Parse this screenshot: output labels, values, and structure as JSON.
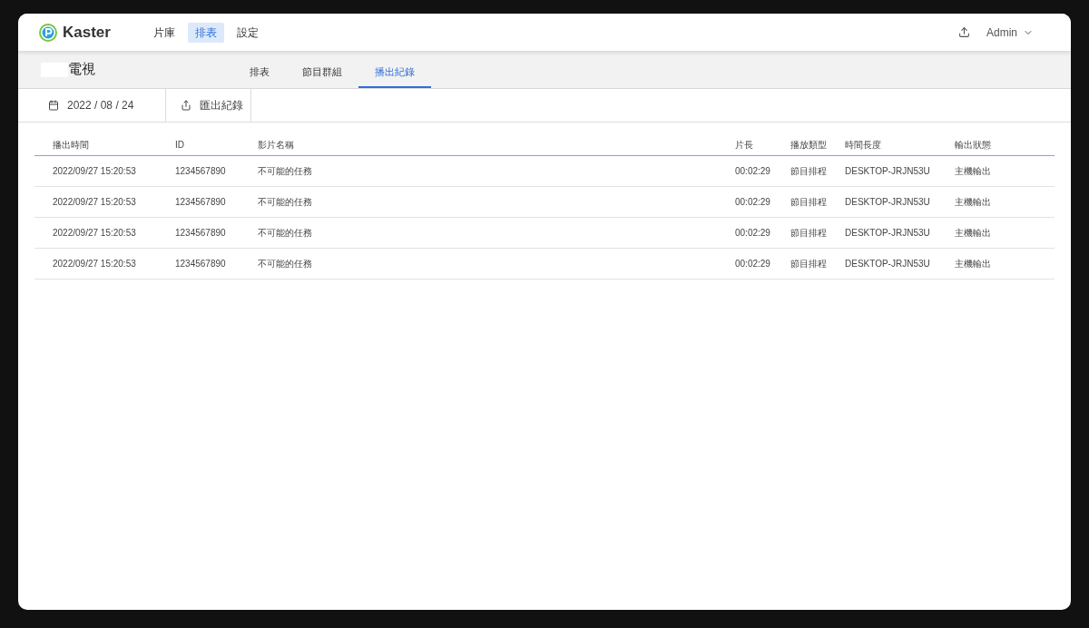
{
  "app": {
    "name": "Kaster"
  },
  "nav": [
    {
      "label": "片庫",
      "selected": false
    },
    {
      "label": "排表",
      "selected": true
    },
    {
      "label": "設定",
      "selected": false
    }
  ],
  "user": {
    "name": "Admin"
  },
  "channel": {
    "title": "電視"
  },
  "tabs": [
    {
      "label": "排表",
      "selected": false
    },
    {
      "label": "節目群組",
      "selected": false
    },
    {
      "label": "播出紀錄",
      "selected": true
    }
  ],
  "toolbar": {
    "date": "2022 / 08 / 24",
    "export_label": "匯出紀錄"
  },
  "table": {
    "columns": [
      "播出時間",
      "ID",
      "影片名稱",
      "片長",
      "播放類型",
      "時間長度",
      "輸出狀態"
    ],
    "rows": [
      [
        "2022/09/27 15:20:53",
        "1234567890",
        "不可能的任務",
        "00:02:29",
        "節目排程",
        "DESKTOP-JRJN53U",
        "主機輸出"
      ],
      [
        "2022/09/27 15:20:53",
        "1234567890",
        "不可能的任務",
        "00:02:29",
        "節目排程",
        "DESKTOP-JRJN53U",
        "主機輸出"
      ],
      [
        "2022/09/27 15:20:53",
        "1234567890",
        "不可能的任務",
        "00:02:29",
        "節目排程",
        "DESKTOP-JRJN53U",
        "主機輸出"
      ],
      [
        "2022/09/27 15:20:53",
        "1234567890",
        "不可能的任務",
        "00:02:29",
        "節目排程",
        "DESKTOP-JRJN53U",
        "主機輸出"
      ]
    ]
  }
}
